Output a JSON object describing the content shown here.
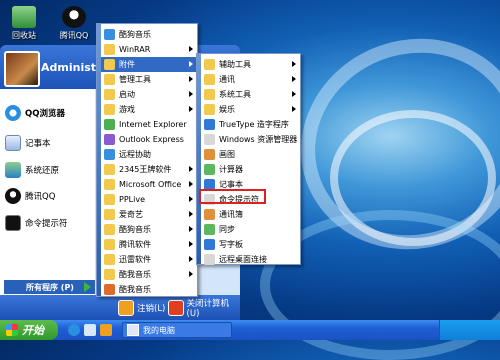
{
  "desktop": {
    "icons": [
      {
        "label": "回收站",
        "icon": "recycle-bin-icon"
      },
      {
        "label": "腾讯QQ",
        "icon": "qq-penguin-icon"
      }
    ]
  },
  "start_menu": {
    "username": "Administ",
    "pinned": [
      {
        "label": "QQ浏览器",
        "icon": "qq-browser-icon"
      },
      {
        "label": "记事本",
        "icon": "notepad-icon"
      },
      {
        "label": "系统还原",
        "icon": "system-restore-icon"
      },
      {
        "label": "腾讯QQ",
        "icon": "qq-penguin-icon"
      },
      {
        "label": "命令提示符",
        "icon": "command-prompt-icon"
      }
    ],
    "all_programs": "所有程序 (P)",
    "logoff": "注销(L)",
    "shutdown": "关闭计算机(U)"
  },
  "programs_menu": {
    "items": [
      {
        "label": "酷狗音乐",
        "submenu": false
      },
      {
        "label": "WinRAR",
        "submenu": true
      },
      {
        "label": "附件",
        "submenu": true,
        "highlighted": true
      },
      {
        "label": "管理工具",
        "submenu": true
      },
      {
        "label": "启动",
        "submenu": true
      },
      {
        "label": "游戏",
        "submenu": true
      },
      {
        "label": "Internet Explorer",
        "submenu": false
      },
      {
        "label": "Outlook Express",
        "submenu": false
      },
      {
        "label": "远程协助",
        "submenu": false
      },
      {
        "label": "2345王牌软件",
        "submenu": true
      },
      {
        "label": "Microsoft Office",
        "submenu": true
      },
      {
        "label": "PPLive",
        "submenu": true
      },
      {
        "label": "爱奇艺",
        "submenu": true
      },
      {
        "label": "酷狗音乐",
        "submenu": true
      },
      {
        "label": "腾讯软件",
        "submenu": true
      },
      {
        "label": "迅雷软件",
        "submenu": true
      },
      {
        "label": "酷我音乐",
        "submenu": true
      },
      {
        "label": "酷我音乐",
        "submenu": false
      }
    ]
  },
  "accessories_menu": {
    "items": [
      {
        "label": "辅助工具",
        "submenu": true
      },
      {
        "label": "通讯",
        "submenu": true
      },
      {
        "label": "系统工具",
        "submenu": true
      },
      {
        "label": "娱乐",
        "submenu": true
      },
      {
        "label": "TrueType 造字程序",
        "submenu": false
      },
      {
        "label": "Windows 资源管理器",
        "submenu": false
      },
      {
        "label": "画图",
        "submenu": false
      },
      {
        "label": "计算器",
        "submenu": false
      },
      {
        "label": "记事本",
        "submenu": false
      },
      {
        "label": "命令提示符",
        "submenu": false,
        "boxed": true
      },
      {
        "label": "通讯簿",
        "submenu": false
      },
      {
        "label": "同步",
        "submenu": false
      },
      {
        "label": "写字板",
        "submenu": false
      },
      {
        "label": "远程桌面连接",
        "submenu": false
      }
    ]
  },
  "taskbar": {
    "start_label": "开始",
    "tasks": [
      {
        "label": "我的电脑"
      }
    ]
  },
  "colors": {
    "highlight": "#316ac5",
    "callout": "#e02020",
    "start_green": "#3a9f33"
  }
}
